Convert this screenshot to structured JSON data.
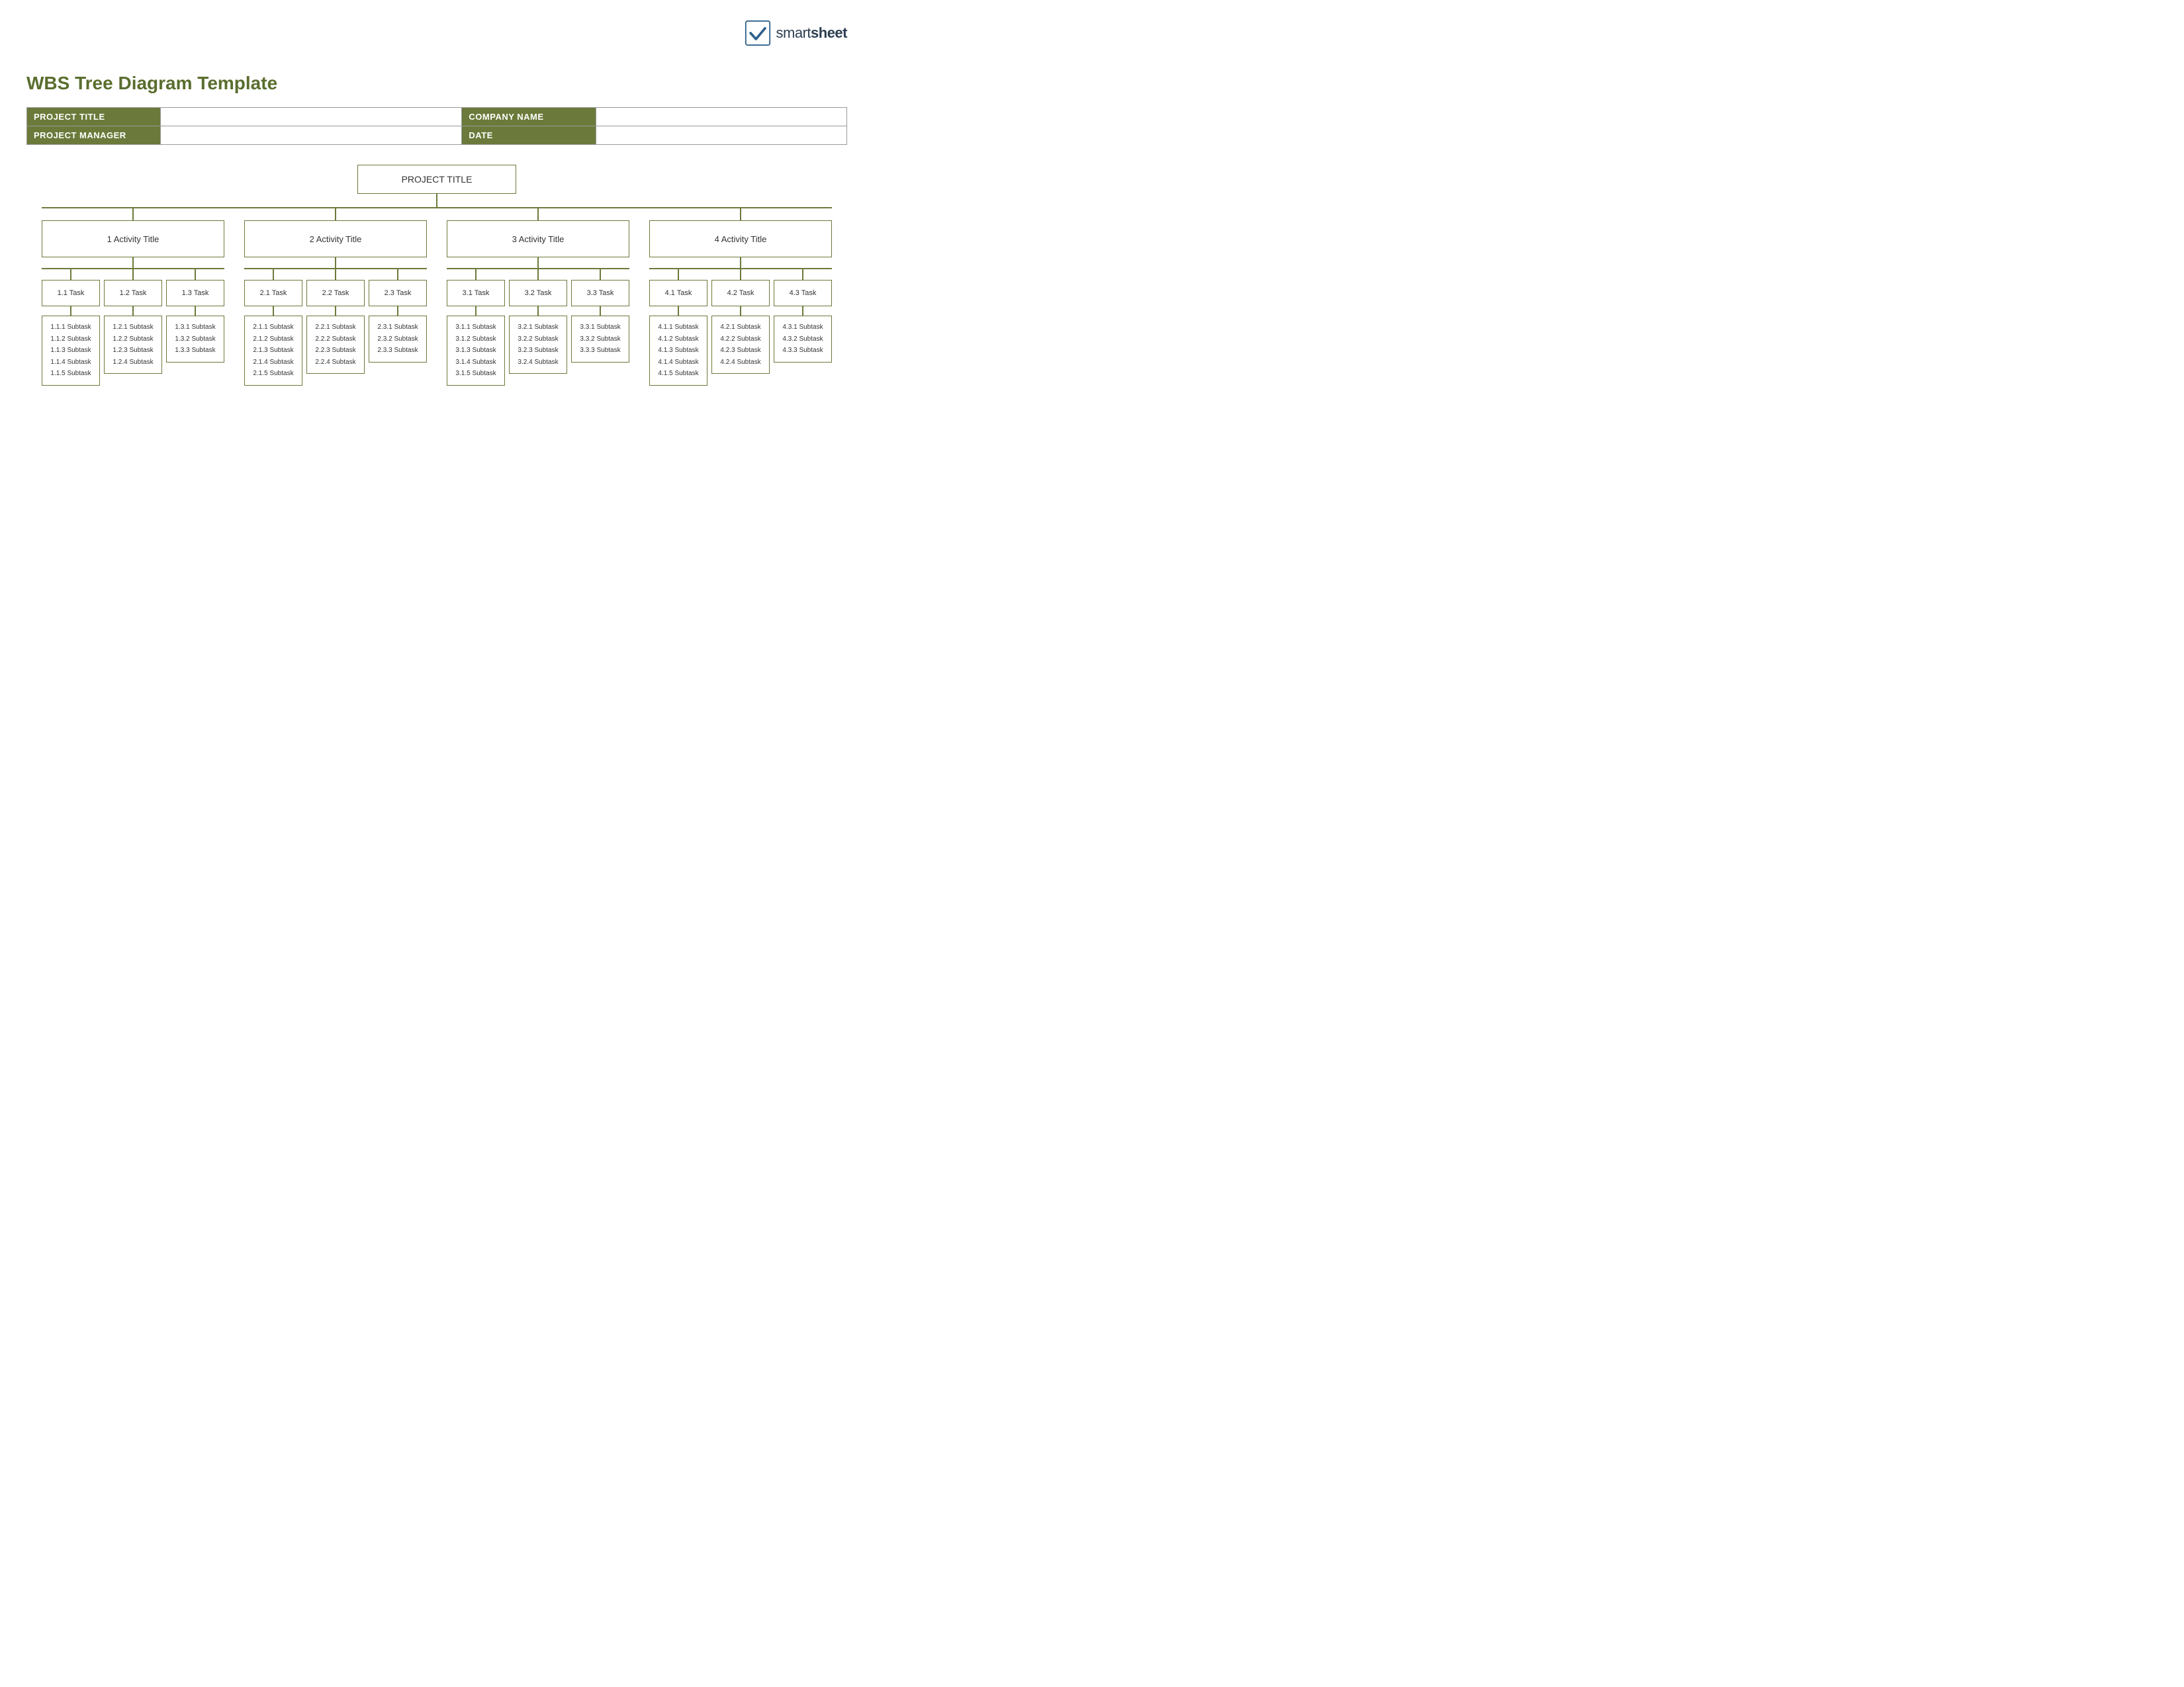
{
  "logo": {
    "text_light": "smart",
    "text_bold": "sheet",
    "checkmark": "✓"
  },
  "page_title": "WBS Tree Diagram Template",
  "info_rows": [
    {
      "label": "PROJECT TITLE",
      "value": "",
      "label2": "COMPANY NAME",
      "value2": ""
    },
    {
      "label": "PROJECT MANAGER",
      "value": "",
      "label2": "DATE",
      "value2": ""
    }
  ],
  "root": {
    "label": "PROJECT TITLE"
  },
  "activities": [
    {
      "label": "1 Activity Title",
      "tasks": [
        {
          "label": "1.1 Task",
          "subtasks": [
            "1.1.1 Subtask",
            "1.1.2 Subtask",
            "1.1.3 Subtask",
            "1.1.4 Subtask",
            "1.1.5 Subtask"
          ]
        },
        {
          "label": "1.2 Task",
          "subtasks": [
            "1.2.1 Subtask",
            "1.2.2 Subtask",
            "1.2.3 Subtask",
            "1.2.4 Subtask"
          ]
        },
        {
          "label": "1.3 Task",
          "subtasks": [
            "1.3.1 Subtask",
            "1.3.2 Subtask",
            "1.3.3 Subtask"
          ]
        }
      ]
    },
    {
      "label": "2 Activity Title",
      "tasks": [
        {
          "label": "2.1 Task",
          "subtasks": [
            "2.1.1 Subtask",
            "2.1.2 Subtask",
            "2.1.3 Subtask",
            "2.1.4 Subtask",
            "2.1.5 Subtask"
          ]
        },
        {
          "label": "2.2 Task",
          "subtasks": [
            "2.2.1 Subtask",
            "2.2.2 Subtask",
            "2.2.3 Subtask",
            "2.2.4 Subtask"
          ]
        },
        {
          "label": "2.3 Task",
          "subtasks": [
            "2.3.1 Subtask",
            "2.3.2 Subtask",
            "2.3.3 Subtask"
          ]
        }
      ]
    },
    {
      "label": "3 Activity Title",
      "tasks": [
        {
          "label": "3.1 Task",
          "subtasks": [
            "3.1.1 Subtask",
            "3.1.2 Subtask",
            "3.1.3 Subtask",
            "3.1.4 Subtask",
            "3.1.5 Subtask"
          ]
        },
        {
          "label": "3.2 Task",
          "subtasks": [
            "3.2.1 Subtask",
            "3.2.2 Subtask",
            "3.2.3 Subtask",
            "3.2.4 Subtask"
          ]
        },
        {
          "label": "3.3 Task",
          "subtasks": [
            "3.3.1 Subtask",
            "3.3.2 Subtask",
            "3.3.3 Subtask"
          ]
        }
      ]
    },
    {
      "label": "4 Activity Title",
      "tasks": [
        {
          "label": "4.1 Task",
          "subtasks": [
            "4.1.1 Subtask",
            "4.1.2 Subtask",
            "4.1.3 Subtask",
            "4.1.4 Subtask",
            "4.1.5 Subtask"
          ]
        },
        {
          "label": "4.2 Task",
          "subtasks": [
            "4.2.1 Subtask",
            "4.2.2 Subtask",
            "4.2.3 Subtask",
            "4.2.4 Subtask"
          ]
        },
        {
          "label": "4.3 Task",
          "subtasks": [
            "4.3.1 Subtask",
            "4.3.2 Subtask",
            "4.3.3 Subtask"
          ]
        }
      ]
    }
  ],
  "colors": {
    "accent": "#6b7a3a",
    "text_dark": "#333333",
    "white": "#ffffff"
  }
}
